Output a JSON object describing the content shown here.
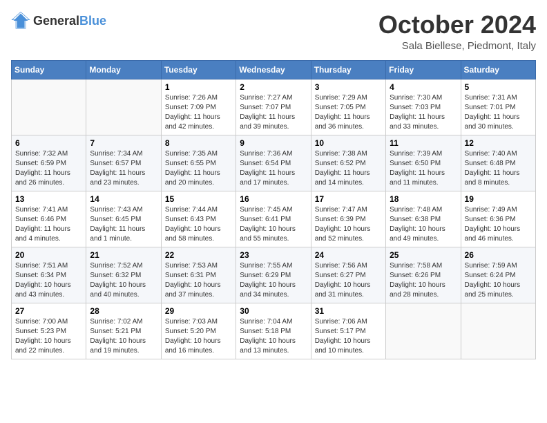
{
  "header": {
    "logo_general": "General",
    "logo_blue": "Blue",
    "month_title": "October 2024",
    "location": "Sala Biellese, Piedmont, Italy"
  },
  "days_of_week": [
    "Sunday",
    "Monday",
    "Tuesday",
    "Wednesday",
    "Thursday",
    "Friday",
    "Saturday"
  ],
  "weeks": [
    [
      {
        "day": "",
        "info": ""
      },
      {
        "day": "",
        "info": ""
      },
      {
        "day": "1",
        "info": "Sunrise: 7:26 AM\nSunset: 7:09 PM\nDaylight: 11 hours and 42 minutes."
      },
      {
        "day": "2",
        "info": "Sunrise: 7:27 AM\nSunset: 7:07 PM\nDaylight: 11 hours and 39 minutes."
      },
      {
        "day": "3",
        "info": "Sunrise: 7:29 AM\nSunset: 7:05 PM\nDaylight: 11 hours and 36 minutes."
      },
      {
        "day": "4",
        "info": "Sunrise: 7:30 AM\nSunset: 7:03 PM\nDaylight: 11 hours and 33 minutes."
      },
      {
        "day": "5",
        "info": "Sunrise: 7:31 AM\nSunset: 7:01 PM\nDaylight: 11 hours and 30 minutes."
      }
    ],
    [
      {
        "day": "6",
        "info": "Sunrise: 7:32 AM\nSunset: 6:59 PM\nDaylight: 11 hours and 26 minutes."
      },
      {
        "day": "7",
        "info": "Sunrise: 7:34 AM\nSunset: 6:57 PM\nDaylight: 11 hours and 23 minutes."
      },
      {
        "day": "8",
        "info": "Sunrise: 7:35 AM\nSunset: 6:55 PM\nDaylight: 11 hours and 20 minutes."
      },
      {
        "day": "9",
        "info": "Sunrise: 7:36 AM\nSunset: 6:54 PM\nDaylight: 11 hours and 17 minutes."
      },
      {
        "day": "10",
        "info": "Sunrise: 7:38 AM\nSunset: 6:52 PM\nDaylight: 11 hours and 14 minutes."
      },
      {
        "day": "11",
        "info": "Sunrise: 7:39 AM\nSunset: 6:50 PM\nDaylight: 11 hours and 11 minutes."
      },
      {
        "day": "12",
        "info": "Sunrise: 7:40 AM\nSunset: 6:48 PM\nDaylight: 11 hours and 8 minutes."
      }
    ],
    [
      {
        "day": "13",
        "info": "Sunrise: 7:41 AM\nSunset: 6:46 PM\nDaylight: 11 hours and 4 minutes."
      },
      {
        "day": "14",
        "info": "Sunrise: 7:43 AM\nSunset: 6:45 PM\nDaylight: 11 hours and 1 minute."
      },
      {
        "day": "15",
        "info": "Sunrise: 7:44 AM\nSunset: 6:43 PM\nDaylight: 10 hours and 58 minutes."
      },
      {
        "day": "16",
        "info": "Sunrise: 7:45 AM\nSunset: 6:41 PM\nDaylight: 10 hours and 55 minutes."
      },
      {
        "day": "17",
        "info": "Sunrise: 7:47 AM\nSunset: 6:39 PM\nDaylight: 10 hours and 52 minutes."
      },
      {
        "day": "18",
        "info": "Sunrise: 7:48 AM\nSunset: 6:38 PM\nDaylight: 10 hours and 49 minutes."
      },
      {
        "day": "19",
        "info": "Sunrise: 7:49 AM\nSunset: 6:36 PM\nDaylight: 10 hours and 46 minutes."
      }
    ],
    [
      {
        "day": "20",
        "info": "Sunrise: 7:51 AM\nSunset: 6:34 PM\nDaylight: 10 hours and 43 minutes."
      },
      {
        "day": "21",
        "info": "Sunrise: 7:52 AM\nSunset: 6:32 PM\nDaylight: 10 hours and 40 minutes."
      },
      {
        "day": "22",
        "info": "Sunrise: 7:53 AM\nSunset: 6:31 PM\nDaylight: 10 hours and 37 minutes."
      },
      {
        "day": "23",
        "info": "Sunrise: 7:55 AM\nSunset: 6:29 PM\nDaylight: 10 hours and 34 minutes."
      },
      {
        "day": "24",
        "info": "Sunrise: 7:56 AM\nSunset: 6:27 PM\nDaylight: 10 hours and 31 minutes."
      },
      {
        "day": "25",
        "info": "Sunrise: 7:58 AM\nSunset: 6:26 PM\nDaylight: 10 hours and 28 minutes."
      },
      {
        "day": "26",
        "info": "Sunrise: 7:59 AM\nSunset: 6:24 PM\nDaylight: 10 hours and 25 minutes."
      }
    ],
    [
      {
        "day": "27",
        "info": "Sunrise: 7:00 AM\nSunset: 5:23 PM\nDaylight: 10 hours and 22 minutes."
      },
      {
        "day": "28",
        "info": "Sunrise: 7:02 AM\nSunset: 5:21 PM\nDaylight: 10 hours and 19 minutes."
      },
      {
        "day": "29",
        "info": "Sunrise: 7:03 AM\nSunset: 5:20 PM\nDaylight: 10 hours and 16 minutes."
      },
      {
        "day": "30",
        "info": "Sunrise: 7:04 AM\nSunset: 5:18 PM\nDaylight: 10 hours and 13 minutes."
      },
      {
        "day": "31",
        "info": "Sunrise: 7:06 AM\nSunset: 5:17 PM\nDaylight: 10 hours and 10 minutes."
      },
      {
        "day": "",
        "info": ""
      },
      {
        "day": "",
        "info": ""
      }
    ]
  ]
}
